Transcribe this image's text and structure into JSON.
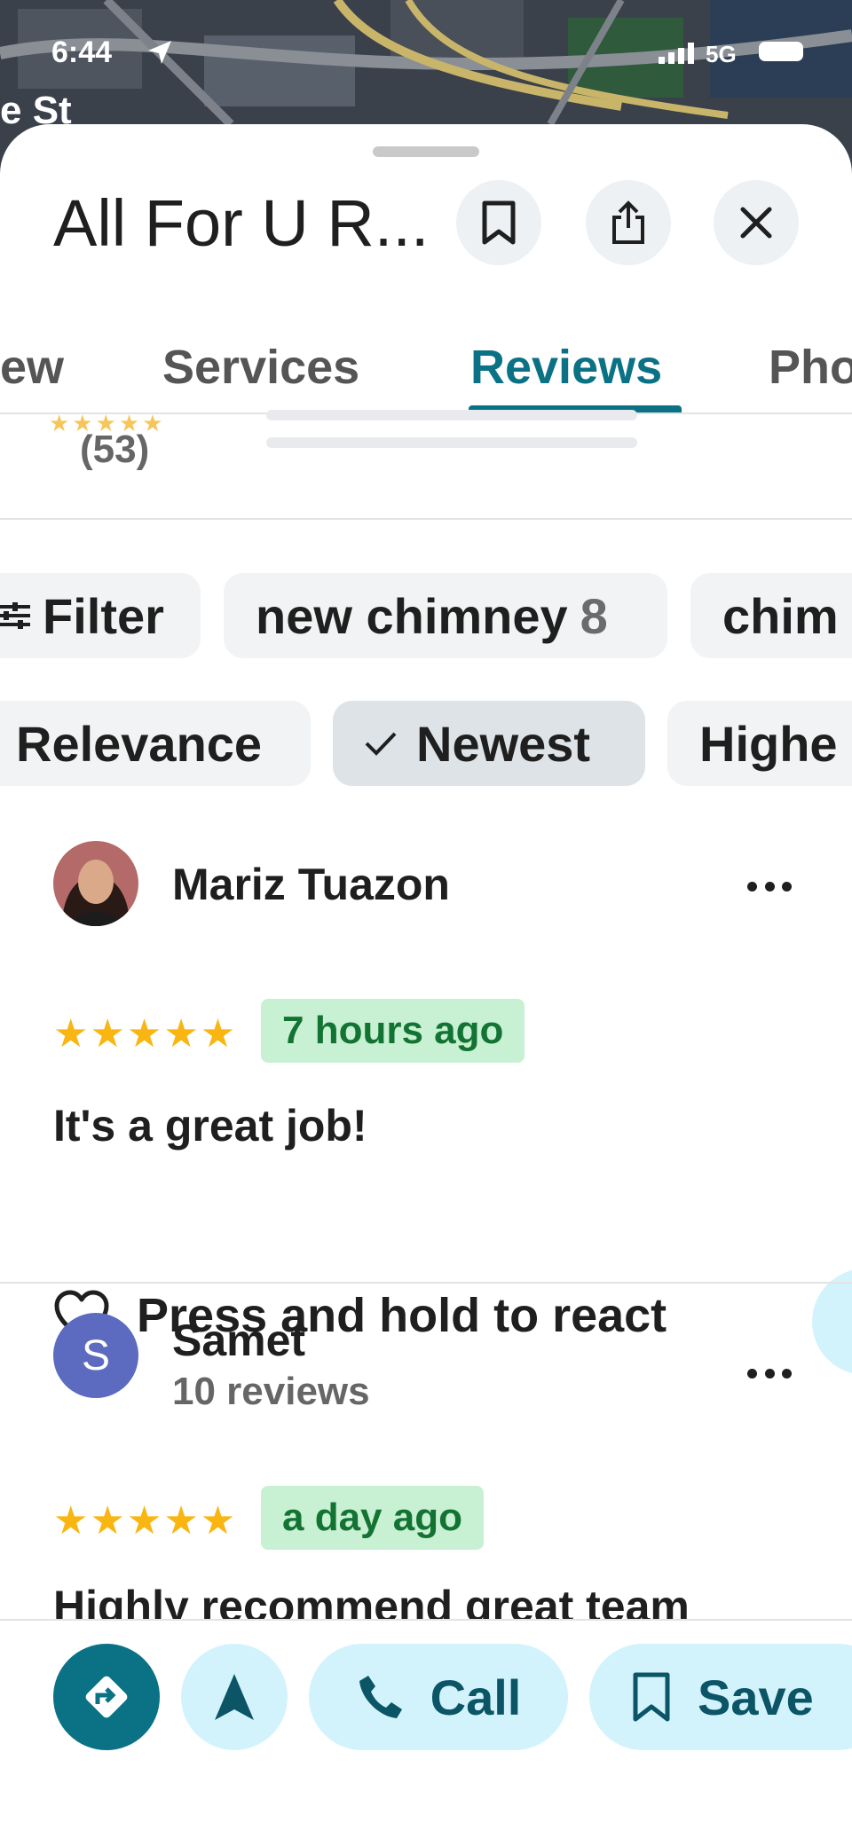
{
  "status_bar": {
    "time": "6:44",
    "network": "5G"
  },
  "map": {
    "street_label": "e St"
  },
  "place": {
    "title": "All For U R..."
  },
  "header_icons": [
    "bookmark-icon",
    "share-icon",
    "close-icon"
  ],
  "tabs": [
    {
      "label": "ew",
      "active": false
    },
    {
      "label": "Services",
      "active": false
    },
    {
      "label": "Reviews",
      "active": true
    },
    {
      "label": "Pho",
      "active": false
    }
  ],
  "rating_summary": {
    "count": "(53)"
  },
  "filter_chips": [
    {
      "label": "Filter",
      "icon": "filter-icon"
    },
    {
      "label": "new chimney",
      "count": "8"
    },
    {
      "label": "chim"
    }
  ],
  "sort_chips": [
    {
      "label": "Relevance",
      "selected": false
    },
    {
      "label": "Newest",
      "selected": true
    },
    {
      "label": "Highe",
      "selected": false
    }
  ],
  "reviews": [
    {
      "name": "Mariz Tuazon",
      "rating": 5,
      "stars": "★★★★★",
      "time": "7 hours ago",
      "text": "It's a great job!",
      "react_label": "Press and hold to react"
    },
    {
      "name": "Samet",
      "avatar_letter": "S",
      "subtitle": "10 reviews",
      "rating": 5,
      "stars": "★★★★★",
      "time": "a day ago",
      "text": "Highly recommend great team"
    }
  ],
  "actions": {
    "call_label": "Call",
    "save_label": "Save"
  },
  "colors": {
    "accent": "#0b7285",
    "star": "#f9b511",
    "badge_bg": "#c8f0d2",
    "badge_text": "#137333",
    "action_bg": "#d3f3fc"
  }
}
